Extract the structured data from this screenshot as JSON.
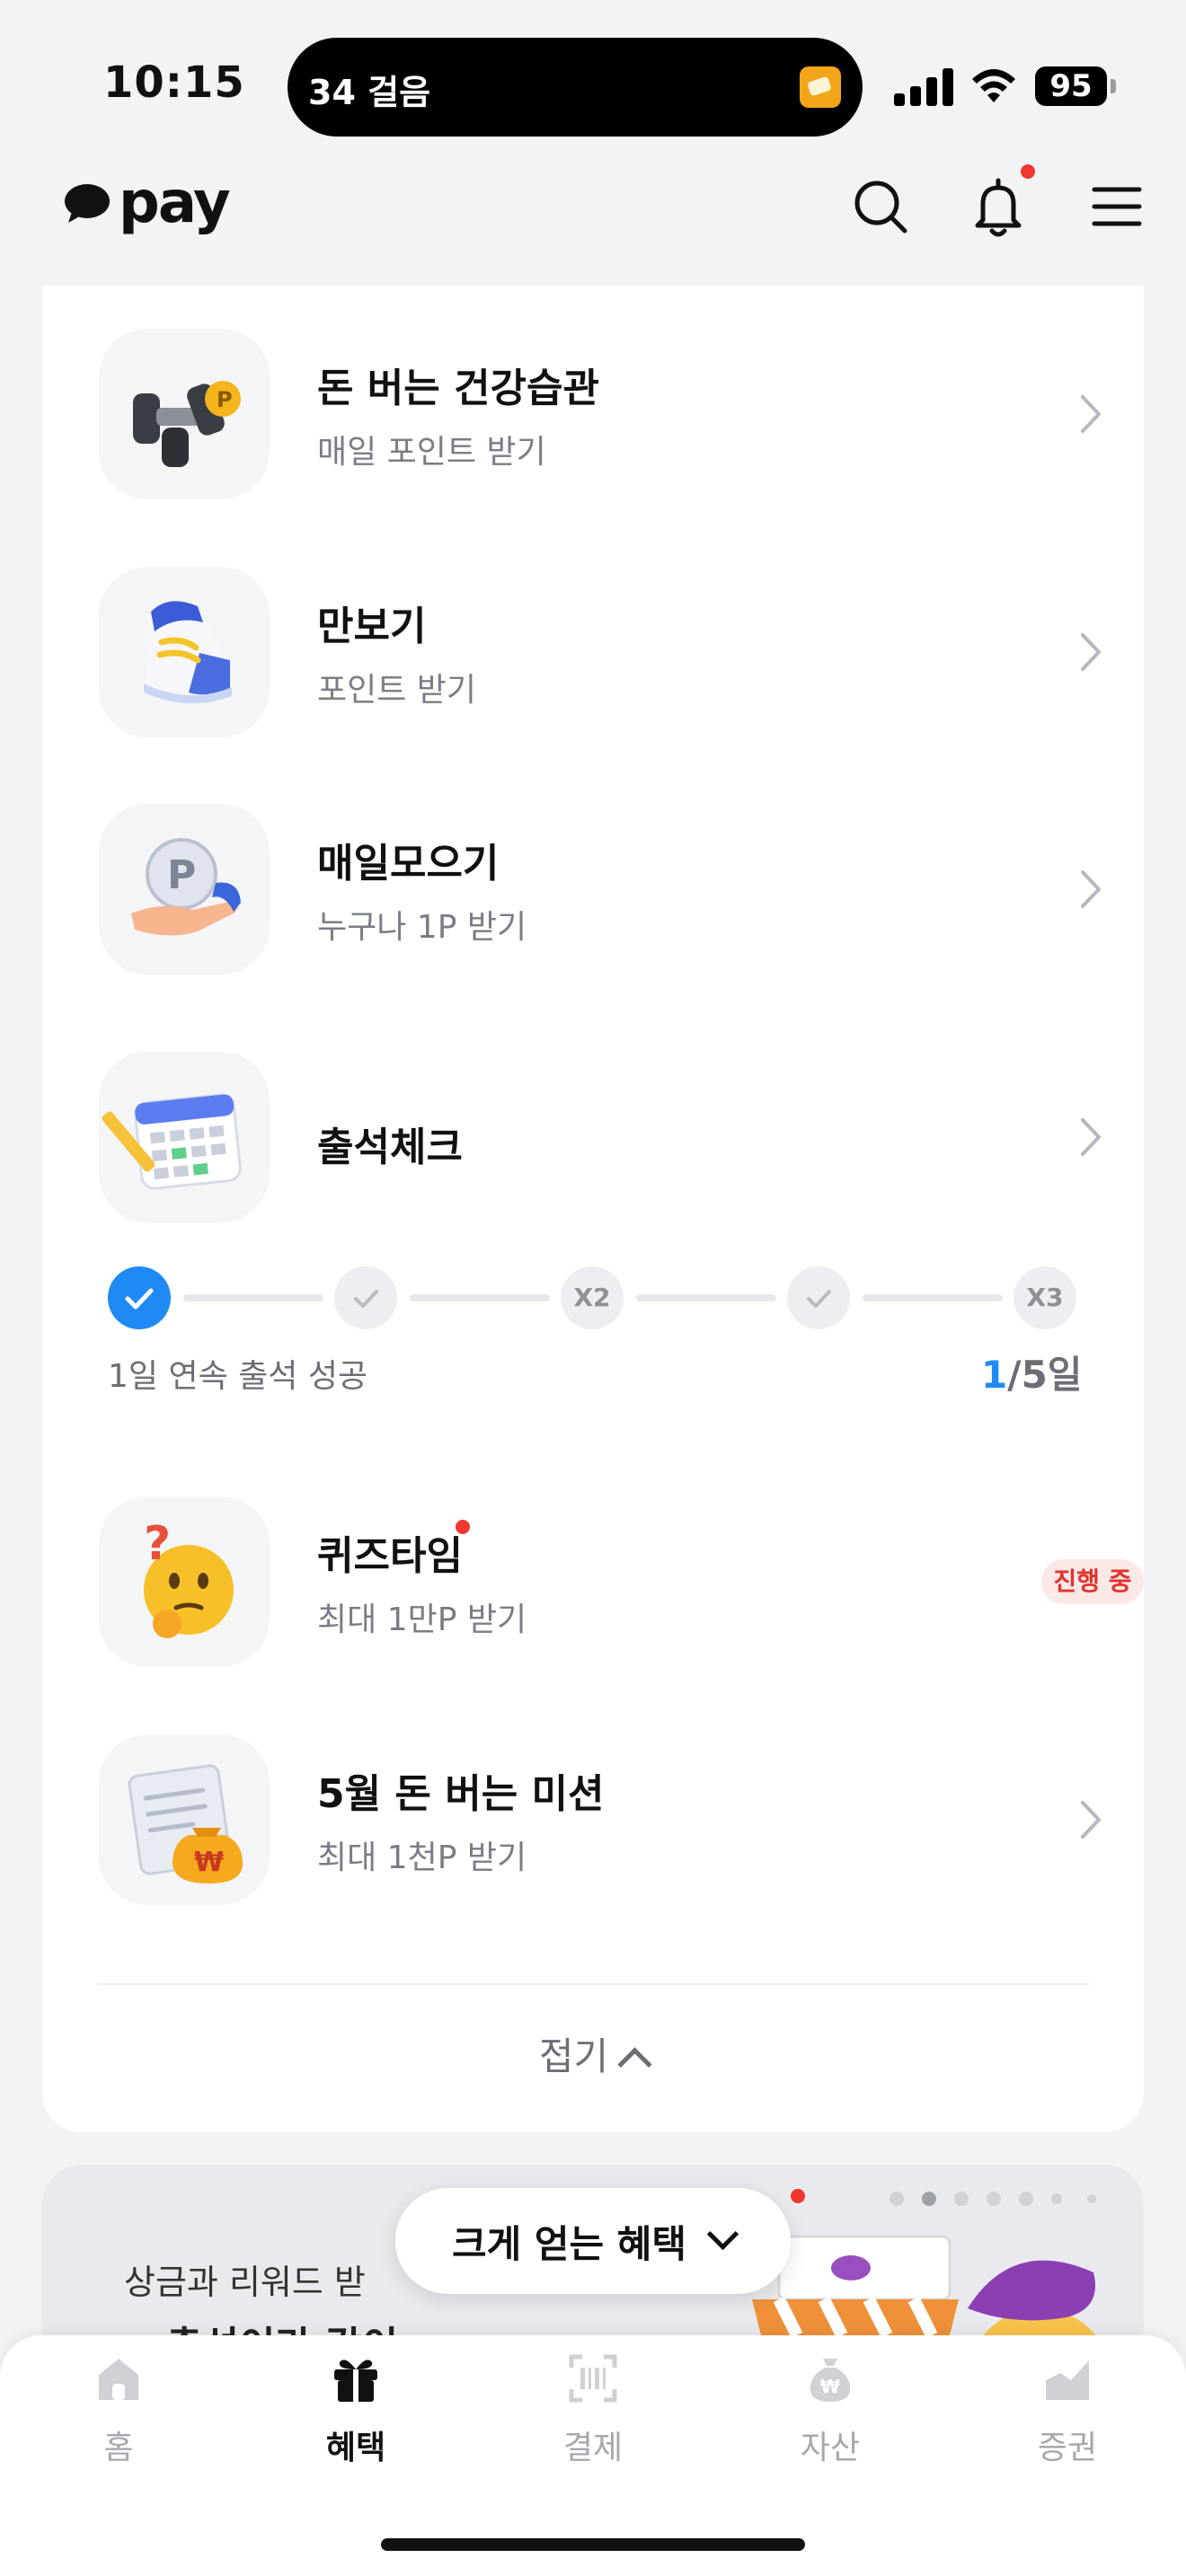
{
  "status_bar": {
    "time": "10:15",
    "live_activity": "34 걸음",
    "battery": "95"
  },
  "header": {
    "logo": "pay"
  },
  "benefits": [
    {
      "title": "돈 버는 건강습관",
      "subtitle": "매일 포인트 받기"
    },
    {
      "title": "만보기",
      "subtitle": "포인트 받기"
    },
    {
      "title": "매일모으기",
      "subtitle": "누구나 1P 받기"
    },
    {
      "title": "출석체크",
      "subtitle": ""
    },
    {
      "title": "퀴즈타임",
      "subtitle": "최대 1만P 받기",
      "badge": "진행 중"
    },
    {
      "title": "5월 돈 버는 미션",
      "subtitle": "최대 1천P 받기"
    }
  ],
  "attendance": {
    "steps": [
      "",
      "",
      "X2",
      "",
      "X3"
    ],
    "completed_steps": 1,
    "message": "1일 연속 출석 성공",
    "current": "1",
    "total": "/5일"
  },
  "fold_label": "접기",
  "banner": {
    "line1": "상금과 리워드 받",
    "line2": "출석이라 감이",
    "float_button": "크게 얻는 혜택"
  },
  "tabs": [
    {
      "label": "홈",
      "icon": "home-icon"
    },
    {
      "label": "혜택",
      "icon": "gift-icon",
      "active": true
    },
    {
      "label": "결제",
      "icon": "barcode-icon"
    },
    {
      "label": "자산",
      "icon": "money-bag-icon"
    },
    {
      "label": "증권",
      "icon": "chart-icon"
    }
  ],
  "colors": {
    "accent": "#1f8af5",
    "notification": "#f0362f",
    "background": "#f2f3f5"
  }
}
